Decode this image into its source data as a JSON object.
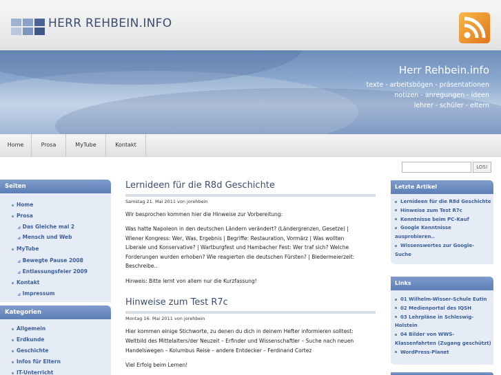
{
  "site": {
    "title": "HERR REHBEIN.INFO",
    "banner_title": "Herr Rehbein.info",
    "banner_lines": [
      "texte - arbeitsbögen - präsentationen",
      "notizen - anregungen - ideen",
      "lehrer - schüler - eltern"
    ]
  },
  "colors": {
    "accent": "#3a4d6e",
    "link": "#3b5f98",
    "sidebar_header": "#6f8fc0",
    "sidebar_bg": "#e6ecf5",
    "rss": "#ef9a2f"
  },
  "icons": {
    "rss": "rss-feed-icon",
    "logo": "grid-logo-icon"
  },
  "nav": [
    "Home",
    "Prosa",
    "MyTube",
    "Kontakt"
  ],
  "search": {
    "placeholder": "",
    "button": "LOS!"
  },
  "left_sidebar": {
    "pages_title": "Seiten",
    "pages": [
      {
        "label": "Home",
        "sub": false
      },
      {
        "label": "Prosa",
        "sub": false
      },
      {
        "label": "Das Gleiche mal 2",
        "sub": true
      },
      {
        "label": "Mensch und Web",
        "sub": true
      },
      {
        "label": "MyTube",
        "sub": false
      },
      {
        "label": "Bewegte Pause 2008",
        "sub": true
      },
      {
        "label": "Entlassungsfeier 2009",
        "sub": true
      },
      {
        "label": "Kontakt",
        "sub": false
      },
      {
        "label": "Impressum",
        "sub": true
      }
    ],
    "categories_title": "Kategorien",
    "categories": [
      "Allgemein",
      "Erdkunde",
      "Geschichte",
      "Infos für Eltern",
      "IT-Unterricht"
    ]
  },
  "posts": [
    {
      "title": "Lernideen für die R8d Geschichte",
      "meta": "Samstag 21. Mai 2011 von jorehbein",
      "paragraphs": [
        [
          "Wir besprochen kommen hier die Hinweise zur Vorbereitung:"
        ],
        [
          "Was hatte Napoleon in den deutschen Ländern verändert? (Ländergrenzen, Gesetze) |",
          "Wiener Kongress: Wer, Was, Ergebnis | Begriffe: Restauration, Vormärz | Was wollten",
          "Liberale und Konservative? | Wartburgfest und Hambacher Fest: Wer traf sich? Welche",
          "Forderungen wurden erhoben? Wie reagierten die deutschen Fürsten? | Biedermeierzeit:",
          "Beschreibe.."
        ],
        [
          "Hinweis: Bitte lernt von allem nur die Kurzfassung!"
        ]
      ]
    },
    {
      "title": "Hinweise zum Test R7c",
      "meta": "Montag 16. Mai 2011 von jorehbein",
      "paragraphs": [
        [
          "Hier kommen einige Stichworte, zu denen du dich in deinem Hefter informieren solltest:",
          "Weltbild des Mittelalters/der Neuzeit – Erfinder und Wissenschaftler – Suche nach neuen",
          "Handelswegen – Kolumbus Reise – andere Entdecker – Ferdinand Cortez"
        ],
        [
          "Viel Erfolg beim Lernen!"
        ]
      ]
    }
  ],
  "right_sidebar": {
    "recent_title": "Letzte Artikel",
    "recent": [
      "Lernideen für die R8d Geschichte",
      "Hinweise zum Test R7c",
      "Kenntnisse beim PC-Kauf",
      "Google Kenntnisse",
      "ausprobieren..",
      "Wissenswertes zur Google-",
      "Suche"
    ],
    "recent_bullets": [
      true,
      true,
      true,
      true,
      false,
      true,
      false
    ],
    "links_title": "Links",
    "links": [
      "01 Wilhelm-Wisser-Schule Eutin",
      "02 Medienportal des IQSH",
      "03 Lehrpläne in Schleswig-",
      "Holstein",
      "04 Bilder von WWS-",
      "Klassenfahrten (Zugang geschützt)",
      "WordPress-Planet"
    ],
    "links_bullets": [
      true,
      true,
      true,
      false,
      true,
      false,
      true
    ]
  }
}
